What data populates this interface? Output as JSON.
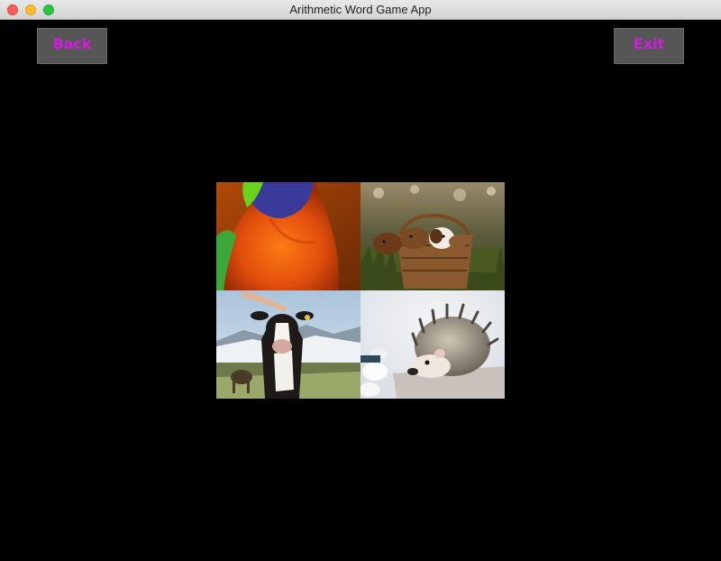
{
  "window": {
    "title": "Arithmetic Word Game App"
  },
  "toolbar": {
    "back_label": "Back",
    "exit_label": "Exit"
  },
  "theme": {
    "background": "#000000",
    "button_bg": "#565656",
    "button_text": "#d21be0"
  },
  "images": [
    {
      "subject": "parrot",
      "icon": "parrot-image"
    },
    {
      "subject": "puppies in basket",
      "icon": "puppies-image"
    },
    {
      "subject": "cow",
      "icon": "cow-image"
    },
    {
      "subject": "hedgehog",
      "icon": "hedgehog-image"
    }
  ]
}
